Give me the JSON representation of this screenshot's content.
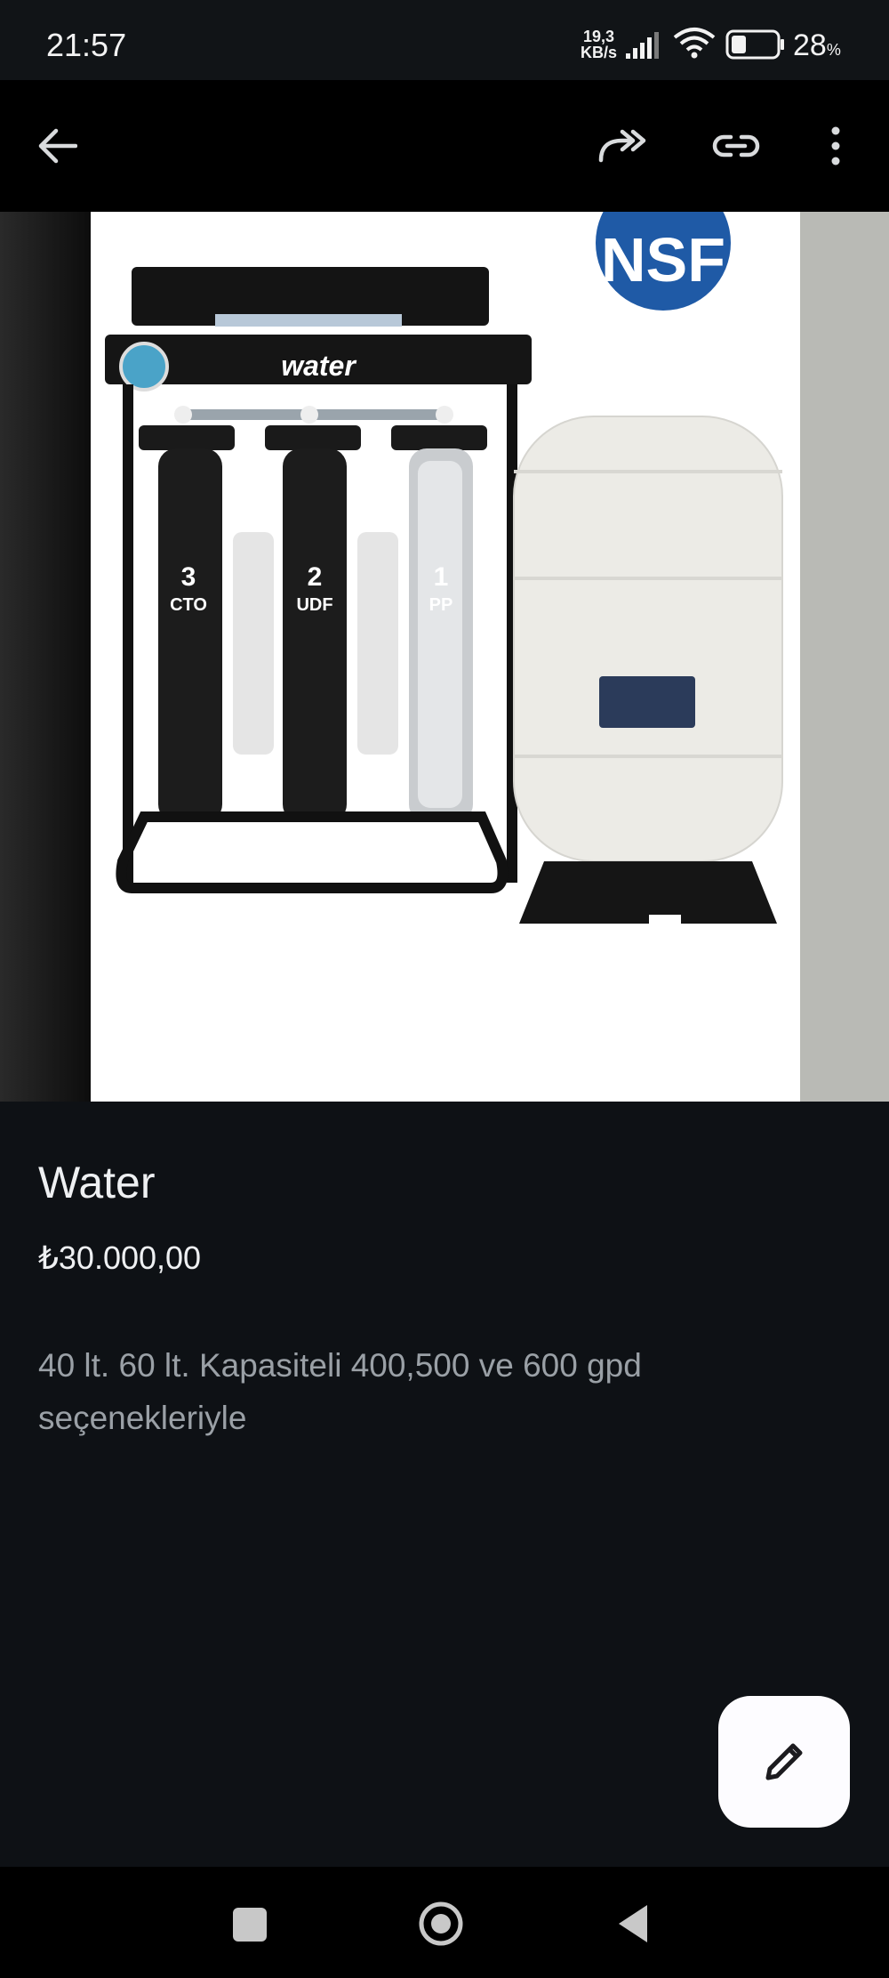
{
  "status_bar": {
    "time": "21:57",
    "net_speed_value": "19,3",
    "net_speed_unit": "KB/s",
    "battery_percent": "28",
    "battery_percent_sign": "%"
  },
  "app_bar": {
    "back_icon": "arrow-left-icon",
    "share_icon": "share-arrow-icon",
    "link_icon": "link-icon",
    "more_icon": "more-vert-icon"
  },
  "product": {
    "image_brand_text": "water",
    "image_badge_text": "NSF",
    "filter_labels": [
      {
        "num": "3",
        "code": "CTO"
      },
      {
        "num": "2",
        "code": "UDF"
      },
      {
        "num": "1",
        "code": "PP"
      }
    ],
    "title": "Water",
    "price": "₺30.000,00",
    "description": "40 lt. 60 lt. Kapasiteli 400,500 ve 600 gpd seçenekleriyle"
  },
  "fab": {
    "icon": "edit-pencil-icon"
  },
  "colors": {
    "background": "#0e1115",
    "status_bar": "#111417",
    "app_bar": "#000000",
    "text_primary": "#eef0f2",
    "text_secondary": "#9aa0a6",
    "fab": "#fdfcff",
    "nsf_blue": "#1f5aa6"
  }
}
